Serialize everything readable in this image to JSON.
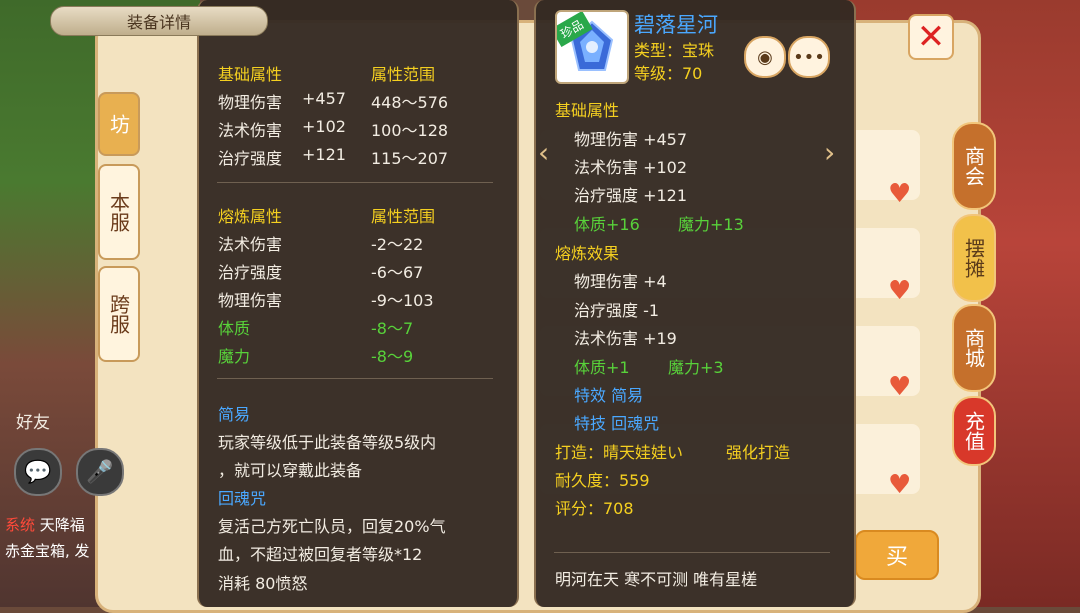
{
  "background": {
    "side_tabs": [
      "坊",
      "本服",
      "跨服"
    ],
    "right_tabs": [
      "商会",
      "摆摊",
      "商城",
      "充值"
    ],
    "friend_label": "好友",
    "chat_lines": [
      {
        "tag": "系统",
        "text": "天降福"
      },
      {
        "tag": "",
        "text": "赤金宝箱, 发"
      }
    ],
    "buy_label": "买",
    "close_icon": "close-icon"
  },
  "tooltip": {
    "title": "装备详情",
    "base_header": "基础属性",
    "range_header": "属性范围",
    "base_stats": [
      {
        "name": "物理伤害",
        "value": "+457",
        "range": "448～576"
      },
      {
        "name": "法术伤害",
        "value": "+102",
        "range": "100～128"
      },
      {
        "name": "治疗强度",
        "value": "+121",
        "range": "115～207"
      }
    ],
    "refine_header": "熔炼属性",
    "refine_range_header": "属性范围",
    "refine_stats": [
      {
        "name": "法术伤害",
        "range": "-2～22",
        "color": "white"
      },
      {
        "name": "治疗强度",
        "range": "-6～67",
        "color": "white"
      },
      {
        "name": "物理伤害",
        "range": "-9～103",
        "color": "white"
      },
      {
        "name": "体质",
        "range": "-8～7",
        "color": "green"
      },
      {
        "name": "魔力",
        "range": "-8～9",
        "color": "green"
      }
    ],
    "effect_name": "简易",
    "effect_desc_1": "玩家等级低于此装备等级5级内",
    "effect_desc_2": "，就可以穿戴此装备",
    "skill_name": "回魂咒",
    "skill_desc_1": "复活己方死亡队员，回复20%气",
    "skill_desc_2": "血，不超过被回复者等级*12",
    "skill_cost": "消耗 80愤怒"
  },
  "detail": {
    "rare_badge": "珍品",
    "name": "碧落星河",
    "type": "类型：宝珠",
    "level": "等级：70",
    "base_header": "基础属性",
    "base_stats": [
      "物理伤害 +457",
      "法术伤害 +102",
      "治疗强度 +121"
    ],
    "base_extra_1": "体质+16",
    "base_extra_2": "魔力+13",
    "refine_header": "熔炼效果",
    "refine_stats": [
      "物理伤害 +4",
      "治疗强度 -1",
      "法术伤害 +19"
    ],
    "refine_extra_1": "体质+1",
    "refine_extra_2": "魔力+3",
    "effect": "特效  简易",
    "skill": "特技  回魂咒",
    "maker_label": "打造：晴天娃娃い",
    "maker_tag": "强化打造",
    "durability": "耐久度：559",
    "score": "评分：708",
    "footer_text": "明河在天  寒不可测  唯有星槎"
  }
}
